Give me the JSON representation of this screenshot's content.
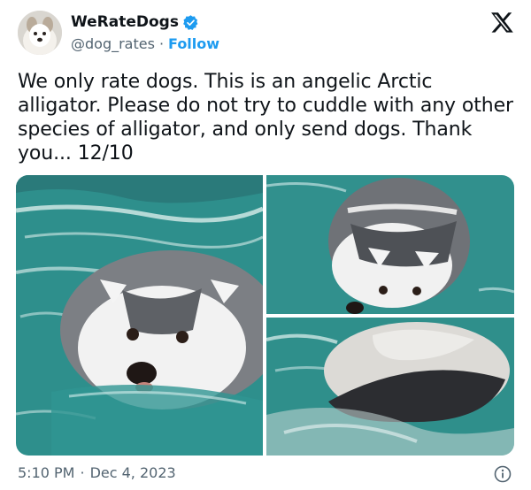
{
  "tweet": {
    "author": {
      "display_name": "WeRateDogs",
      "handle": "@dog_rates",
      "separator": "·",
      "follow_label": "Follow"
    },
    "text": "We only rate dogs. This is an angelic Arctic alligator. Please do not try to cuddle with any other species of alligator, and only send dogs. Thank you... 12/10",
    "time": "5:10 PM",
    "date_separator": "·",
    "date": "Dec 4, 2023"
  },
  "icons": {
    "verified": "verified-badge-icon",
    "brand": "x-logo-icon",
    "info": "info-icon"
  },
  "colors": {
    "accent": "#1d9bf0",
    "text": "#0f1419",
    "muted": "#536471",
    "water": "#2f8f8c"
  }
}
